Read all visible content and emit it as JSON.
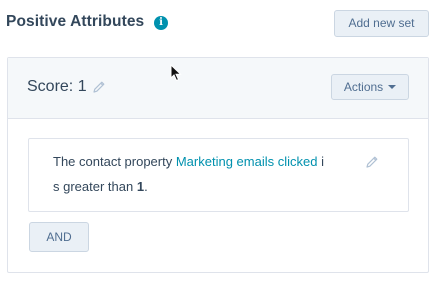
{
  "section": {
    "title": "Positive Attributes",
    "info_icon": "info-icon",
    "add_set_label": "Add new set"
  },
  "score_set": {
    "score_label": "Score: 1",
    "actions_label": "Actions",
    "rule": {
      "prefix": "The contact property ",
      "property": "Marketing emails clicked",
      "line1_suffix": " i",
      "line2_prefix": "s greater than ",
      "value": "1",
      "line2_suffix": "."
    },
    "and_label": "AND"
  },
  "colors": {
    "accent_link": "#0091ae",
    "text": "#33475b",
    "button_bg": "#eaf0f6",
    "panel_bg": "#f5f8fa"
  }
}
